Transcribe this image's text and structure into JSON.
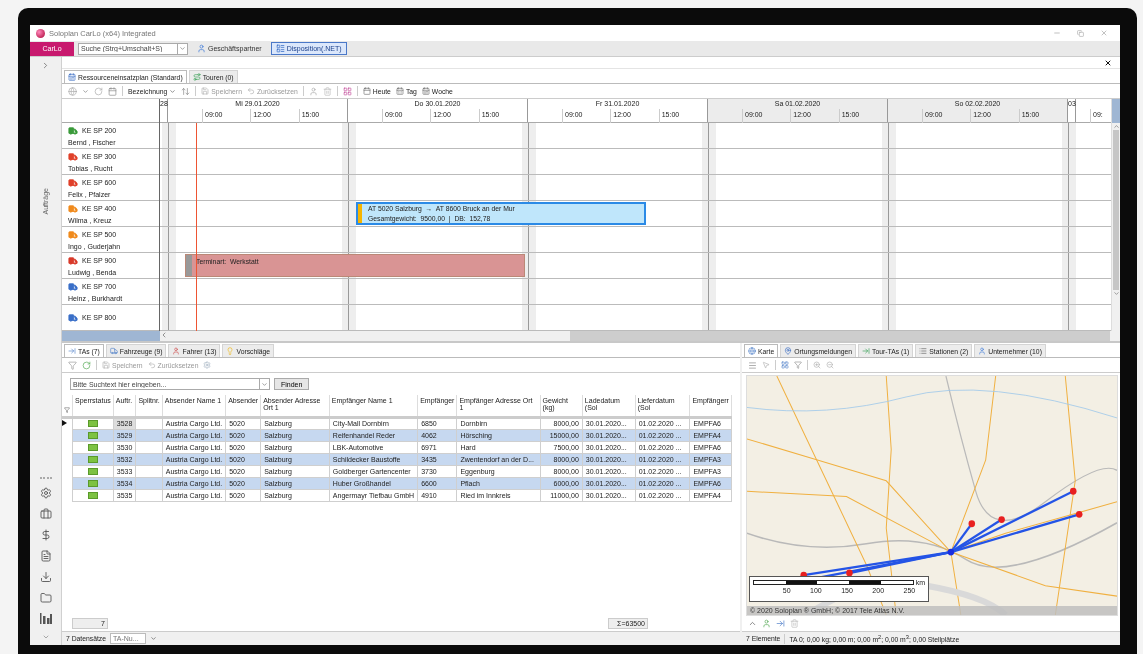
{
  "window": {
    "title": "Soloplan CarLo (x64) Integrated"
  },
  "menu_bar": {
    "app_button": "CarLo",
    "search": {
      "placeholder": "Suche (Strg+Umschalt+S)"
    },
    "items": [
      {
        "label": "Geschäftspartner",
        "kind": "person",
        "selected": false
      },
      {
        "label": "Disposition(.NET)",
        "kind": "plan",
        "selected": true
      }
    ]
  },
  "sidebar": {
    "label": "Aufträge"
  },
  "plan": {
    "tabs": [
      {
        "label": "Ressourceneinsatzplan (Standard)",
        "selected": true
      },
      {
        "label": "Touren (0)",
        "selected": false
      }
    ],
    "toolbar": {
      "sort": "Bezeichnung",
      "save": "Speichern",
      "reset": "Zurücksetzen",
      "today": "Heute",
      "day": "Tag",
      "week": "Woche"
    },
    "days": [
      {
        "label": "28",
        "kind": "partial",
        "weekend": false
      },
      {
        "label": "Mi 29.01.2020",
        "kind": "full",
        "weekend": false,
        "hours": [
          "09:00",
          "12:00",
          "15:00"
        ]
      },
      {
        "label": "Do 30.01.2020",
        "kind": "full",
        "weekend": false,
        "hours": [
          "09:00",
          "12:00",
          "15:00"
        ]
      },
      {
        "label": "Fr 31.01.2020",
        "kind": "full",
        "weekend": false,
        "hours": [
          "09:00",
          "12:00",
          "15:00"
        ]
      },
      {
        "label": "Sa 01.02.2020",
        "kind": "full",
        "weekend": true,
        "hours": [
          "09:00",
          "12:00",
          "15:00"
        ]
      },
      {
        "label": "So 02.02.2020",
        "kind": "full",
        "weekend": true,
        "hours": [
          "09:00",
          "12:00",
          "15:00"
        ]
      },
      {
        "label": "03",
        "kind": "partial",
        "weekend": false,
        "hours": [
          "09:"
        ]
      }
    ],
    "resources": [
      {
        "vehicle": "KE SP 200",
        "driver": "Bernd , Fischer",
        "color": "#3a9a3a"
      },
      {
        "vehicle": "KE SP 300",
        "driver": "Tobias , Rucht",
        "color": "#e0402a"
      },
      {
        "vehicle": "KE SP 600",
        "driver": "Felix , Pfalzer",
        "color": "#e0402a"
      },
      {
        "vehicle": "KE SP 400",
        "driver": "Wilma , Kreuz",
        "color": "#f08a1c",
        "events": [
          {
            "kind": "tour",
            "line_1": "AT 5020 Salzburg  →  AT 8600 Bruck an der Mur",
            "line_2": "Gesamtgewicht:  9500,00  |  DB:  152,78"
          }
        ]
      },
      {
        "vehicle": "KE SP 500",
        "driver": "Ingo , Guderjahn",
        "color": "#f08a1c"
      },
      {
        "vehicle": "KE SP 900",
        "driver": "Ludwig , Benda",
        "color": "#d83a2a",
        "events": [
          {
            "kind": "appointment",
            "line_1": "Terminart:  Werkstatt"
          }
        ]
      },
      {
        "vehicle": "KE SP 700",
        "driver": "Heinz , Burkhardt",
        "color": "#3a6fc8"
      },
      {
        "vehicle": "KE SP 800",
        "color": "#3a6fc8"
      }
    ]
  },
  "orders": {
    "tabs": [
      {
        "label": "TAs (7)",
        "selected": true
      },
      {
        "label": "Fahrzeuge (9)",
        "selected": false
      },
      {
        "label": "Fahrer (13)",
        "selected": false
      },
      {
        "label": "Vorschläge",
        "selected": false
      }
    ],
    "toolbar": {
      "save": "Speichern",
      "reset": "Zurücksetzen"
    },
    "search": {
      "placeholder": "Bitte Suchtext hier eingeben...",
      "button": "Finden"
    },
    "columns": [
      {
        "label": "Sperrstatus",
        "kind": "status"
      },
      {
        "label": "Auftr.",
        "kind": "number"
      },
      {
        "label": "Splitnr.",
        "kind": "text"
      },
      {
        "label": "Absender Name 1",
        "kind": "text"
      },
      {
        "label": "Absender",
        "kind": "text"
      },
      {
        "label": "Absender Adresse Ort 1",
        "kind": "text"
      },
      {
        "label": "Empfänger Name 1",
        "kind": "text"
      },
      {
        "label": "Empfänger",
        "kind": "text"
      },
      {
        "label": "Empfänger Adresse Ort 1",
        "kind": "text"
      },
      {
        "label": "Gewicht (kg)",
        "kind": "number"
      },
      {
        "label": "Ladedatum (Sol",
        "kind": "text"
      },
      {
        "label": "Lieferdatum (Sol",
        "kind": "text"
      },
      {
        "label": "Empfängerr",
        "kind": "text"
      }
    ],
    "rows": [
      {
        "current": true,
        "selected": false,
        "locked": false,
        "cells": [
          "",
          "3528",
          "",
          "Austria Cargo Ltd.",
          "5020",
          "Salzburg",
          "City-Mall Dornbirn",
          "6850",
          "Dornbirn",
          "8000,00",
          "30.01.2020...",
          "01.02.2020 ...",
          "EMPFA6"
        ]
      },
      {
        "current": false,
        "selected": true,
        "locked": false,
        "cells": [
          "",
          "3529",
          "",
          "Austria Cargo Ltd.",
          "5020",
          "Salzburg",
          "Reifenhandel Reder",
          "4062",
          "Hörsching",
          "15000,00",
          "30.01.2020...",
          "01.02.2020 ...",
          "EMPFA4"
        ]
      },
      {
        "current": false,
        "selected": false,
        "locked": false,
        "cells": [
          "",
          "3530",
          "",
          "Austria Cargo Ltd.",
          "5020",
          "Salzburg",
          "LBK-Automotive",
          "6971",
          "Hard",
          "7500,00",
          "30.01.2020...",
          "01.02.2020 ...",
          "EMPFA6"
        ]
      },
      {
        "current": false,
        "selected": true,
        "locked": false,
        "cells": [
          "",
          "3532",
          "",
          "Austria Cargo Ltd.",
          "5020",
          "Salzburg",
          "Schildecker Baustoffe",
          "3435",
          "Zwentendorf an der D...",
          "8000,00",
          "30.01.2020...",
          "01.02.2020 ...",
          "EMPFA3"
        ]
      },
      {
        "current": false,
        "selected": false,
        "locked": false,
        "cells": [
          "",
          "3533",
          "",
          "Austria Cargo Ltd.",
          "5020",
          "Salzburg",
          "Goldberger Gartencenter",
          "3730",
          "Eggenburg",
          "8000,00",
          "30.01.2020...",
          "01.02.2020 ...",
          "EMPFA3"
        ]
      },
      {
        "current": false,
        "selected": true,
        "locked": false,
        "cells": [
          "",
          "3534",
          "",
          "Austria Cargo Ltd.",
          "5020",
          "Salzburg",
          "Huber Großhandel",
          "6600",
          "Pflach",
          "6000,00",
          "30.01.2020...",
          "01.02.2020 ...",
          "EMPFA6"
        ]
      },
      {
        "current": false,
        "selected": false,
        "locked": false,
        "cells": [
          "",
          "3535",
          "",
          "Austria Cargo Ltd.",
          "5020",
          "Salzburg",
          "Angermayr Tiefbau GmbH",
          "4910",
          "Ried im Innkreis",
          "11000,00",
          "30.01.2020...",
          "01.02.2020 ...",
          "EMPFA4"
        ]
      }
    ],
    "footer": {
      "count": "7",
      "sum": "Σ=63500"
    },
    "status_bar": {
      "records": "7 Datensätze",
      "filter": {
        "placeholder": "TA-Nu..."
      }
    }
  },
  "map_panel": {
    "tabs": [
      {
        "label": "Karte",
        "kind": "globe",
        "selected": true
      },
      {
        "label": "Ortungsmeldungen",
        "kind": "pin",
        "selected": false
      },
      {
        "label": "Tour-TAs (1)",
        "kind": "arrow",
        "selected": false
      },
      {
        "label": "Stationen (2)",
        "kind": "list",
        "selected": false
      },
      {
        "label": "Unternehmer (10)",
        "kind": "person",
        "selected": false
      }
    ],
    "scale_labels": [
      "50",
      "100",
      "150",
      "200",
      "250"
    ],
    "scale_unit": "km",
    "copyright": "© 2020 Soloplan ® GmbH; © 2017 Tele Atlas N.V.",
    "status_bar": {
      "count": "7 Elemente",
      "summary": "TA 0; 0,00 kg; 0,00 m; 0,00 m$^{2}$; 0,00 m$^{3}$; 0,00 Stellplätze"
    }
  }
}
